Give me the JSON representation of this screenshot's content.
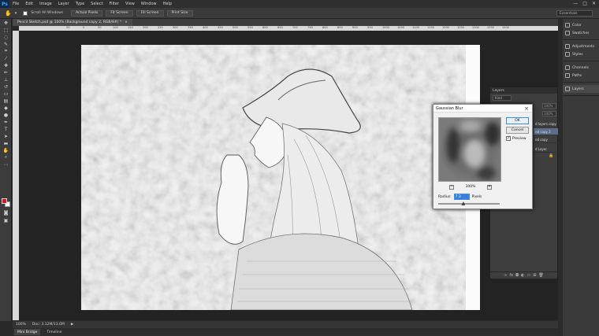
{
  "menubar": {
    "logo": "Ps",
    "items": [
      "File",
      "Edit",
      "Image",
      "Layer",
      "Type",
      "Select",
      "Filter",
      "View",
      "Window",
      "Help"
    ],
    "controls": [
      "—",
      "□",
      "✕"
    ]
  },
  "options": {
    "scroll_all": "Scroll All Windows",
    "buttons": [
      "Actual Pixels",
      "Fit Screen",
      "Fill Screen",
      "Print Size"
    ],
    "workspace": "Essentials"
  },
  "document": {
    "tab": "Pencil Sketch.psd @ 100% (Background copy 2, RGB/8#) *"
  },
  "ruler": {
    "marks": [
      "50",
      "0",
      "50",
      "100",
      "150",
      "200",
      "250",
      "300",
      "350",
      "400",
      "450",
      "500",
      "550",
      "600",
      "650",
      "700",
      "750",
      "800",
      "850",
      "900",
      "950",
      "1000",
      "1050",
      "1100",
      "1150",
      "1200",
      "1250",
      "1300",
      "1350",
      "1400"
    ]
  },
  "status": {
    "zoom": "100%",
    "doc": "Doc: 3.12M/13.6M"
  },
  "bottom_tabs": [
    "Mini Bridge",
    "Timeline"
  ],
  "panels": {
    "items": [
      {
        "label": "Color"
      },
      {
        "label": "Swatches"
      },
      {
        "label": "Adjustments"
      },
      {
        "label": "Styles"
      },
      {
        "label": "Channels"
      },
      {
        "label": "Paths"
      },
      {
        "label": "Layers"
      }
    ]
  },
  "layers_panel": {
    "title": "Layers",
    "kind": "Kind",
    "opacity": "100%",
    "rows": [
      "d layers copy",
      "nd copy 2",
      "nd copy",
      "d Layer"
    ]
  },
  "dialog": {
    "title": "Gaussian Blur",
    "ok": "OK",
    "cancel": "Cancel",
    "preview_label": "Preview",
    "zoom": "100%",
    "radius_label": "Radius:",
    "radius_value": "7.3",
    "units": "Pixels",
    "radius_fraction": 0.41
  }
}
